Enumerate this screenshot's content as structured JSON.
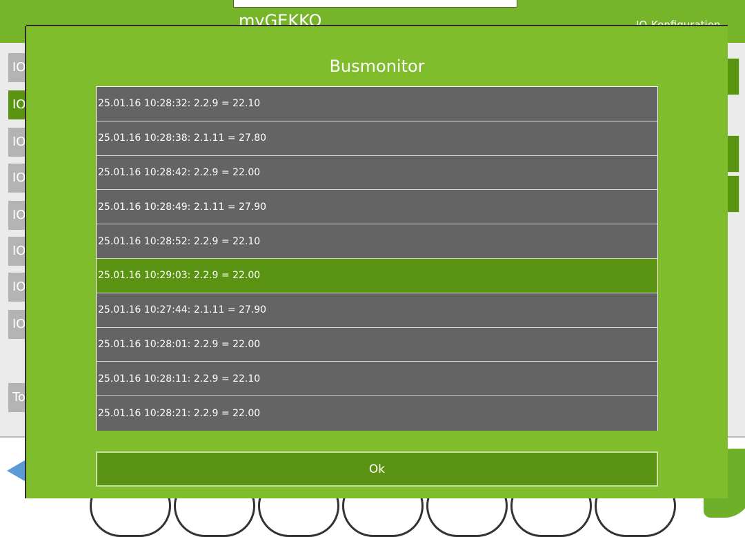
{
  "app": {
    "title": "myGEKKO",
    "page_title": "IO-Konfiguration"
  },
  "sidebar": {
    "items": [
      {
        "label": "IO"
      },
      {
        "label": "IO"
      },
      {
        "label": "IO"
      },
      {
        "label": "IO"
      },
      {
        "label": "IO"
      },
      {
        "label": "IO"
      },
      {
        "label": "IO"
      },
      {
        "label": "IO"
      }
    ],
    "bottom_label": "To"
  },
  "dialog": {
    "title": "Busmonitor",
    "entries": [
      "25.01.16 10:28:32: 2.2.9 = 22.10",
      "25.01.16 10:28:38: 2.1.11 = 27.80",
      "25.01.16 10:28:42: 2.2.9 = 22.00",
      "25.01.16 10:28:49: 2.1.11 = 27.90",
      "25.01.16 10:28:52: 2.2.9 = 22.10",
      "25.01.16 10:29:03: 2.2.9 = 22.00",
      "25.01.16 10:27:44: 2.1.11 = 27.90",
      "25.01.16 10:28:01: 2.2.9 = 22.00",
      "25.01.16 10:28:11: 2.2.9 = 22.10",
      "25.01.16 10:28:21: 2.2.9 = 22.00"
    ],
    "selected_index": 5,
    "ok_label": "Ok"
  },
  "colors": {
    "brand_green": "#80bd2c",
    "selected_green": "#5a9312",
    "row_gray": "#646464"
  }
}
